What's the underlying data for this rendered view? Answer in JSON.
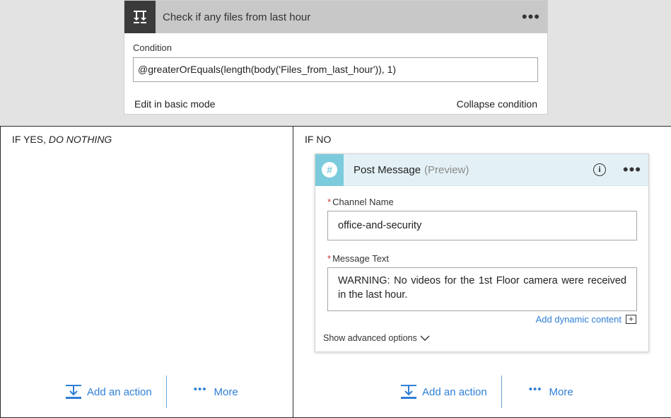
{
  "condition": {
    "title": "Check if any files from last hour",
    "menu": "•••",
    "label": "Condition",
    "expression": "@greaterOrEquals(length(body('Files_from_last_hour')), 1)",
    "edit_basic": "Edit in basic mode",
    "collapse": "Collapse condition"
  },
  "branch_yes": {
    "label_prefix": "IF YES, ",
    "label_italic": "DO NOTHING",
    "add_action": "Add an action",
    "more": "More",
    "more_dots": "•••"
  },
  "branch_no": {
    "label": "IF NO",
    "add_action": "Add an action",
    "more": "More",
    "more_dots": "•••"
  },
  "post_message": {
    "title": "Post Message",
    "preview": "(Preview)",
    "info": "i",
    "menu": "•••",
    "icon_glyph": "#",
    "channel_label": "Channel Name",
    "channel_value": "office-and-security",
    "message_label": "Message Text",
    "message_value": "WARNING: No videos for the 1st Floor camera were received in the last hour.",
    "required_marker": "*",
    "dynamic_content": "Add dynamic content",
    "dynamic_plus": "+",
    "advanced": "Show advanced options"
  },
  "colors": {
    "accent": "#2f7fd6",
    "condition_header": "#c8c8c8",
    "condition_icon_bg": "#3a3a3a",
    "slack_icon_bg": "#7ccbdd",
    "slack_header": "#e3f1f6"
  },
  "icons": {
    "condition": "condition-icon",
    "slack": "slack-icon",
    "info": "info-icon",
    "add_action": "add-action-icon",
    "chevron": "chevron-down-icon"
  }
}
